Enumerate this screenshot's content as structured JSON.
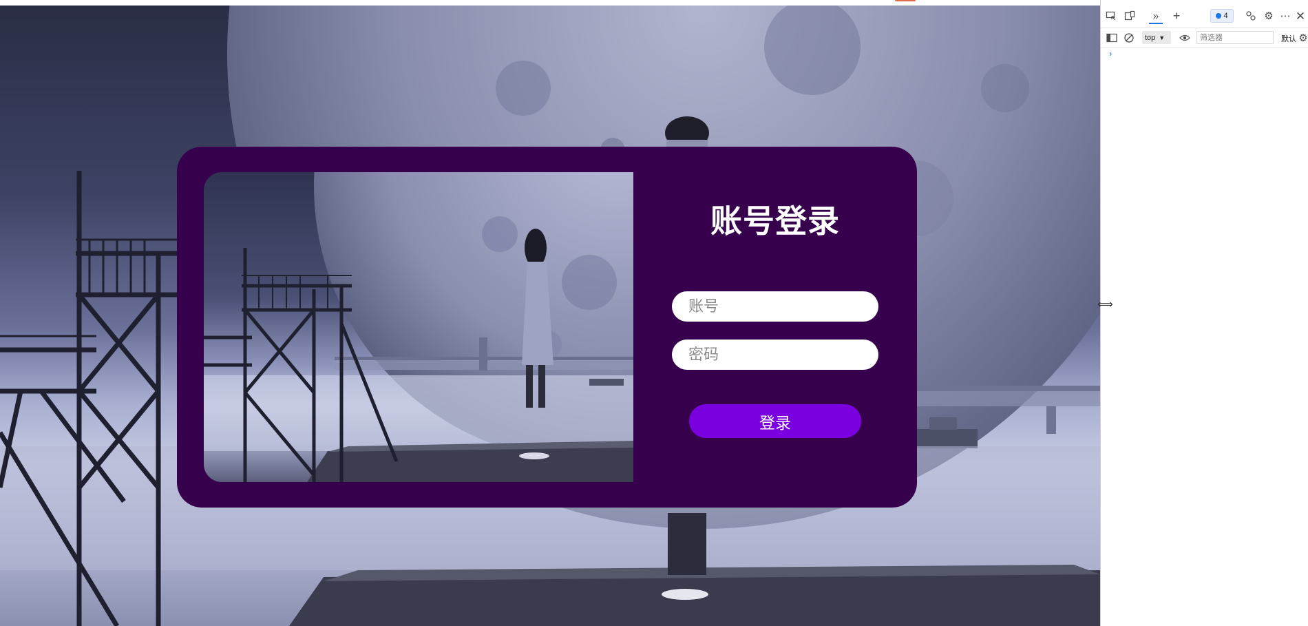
{
  "login": {
    "title": "账号登录",
    "account_placeholder": "账号",
    "password_placeholder": "密码",
    "submit_label": "登录"
  },
  "devtools": {
    "issues_count": "4",
    "context": "top",
    "filter_placeholder": "筛选器",
    "levels_label": "默认"
  },
  "colors": {
    "card_background": "#37004c",
    "button_background": "#7b00e0",
    "title_text": "#ffffff"
  },
  "icons": {
    "device_toolbar": "inspect-device-icon",
    "device_mode": "device-mode-icon",
    "more_tabs": "chevron-double-right-icon",
    "new_tab": "plus-icon",
    "settings": "gear-icon",
    "more": "more-horizontal-icon",
    "close": "close-icon",
    "sidebar": "sidebar-toggle-icon",
    "clear": "clear-console-icon",
    "live_expression": "eye-icon",
    "console_prompt": "chevron-right-icon"
  }
}
